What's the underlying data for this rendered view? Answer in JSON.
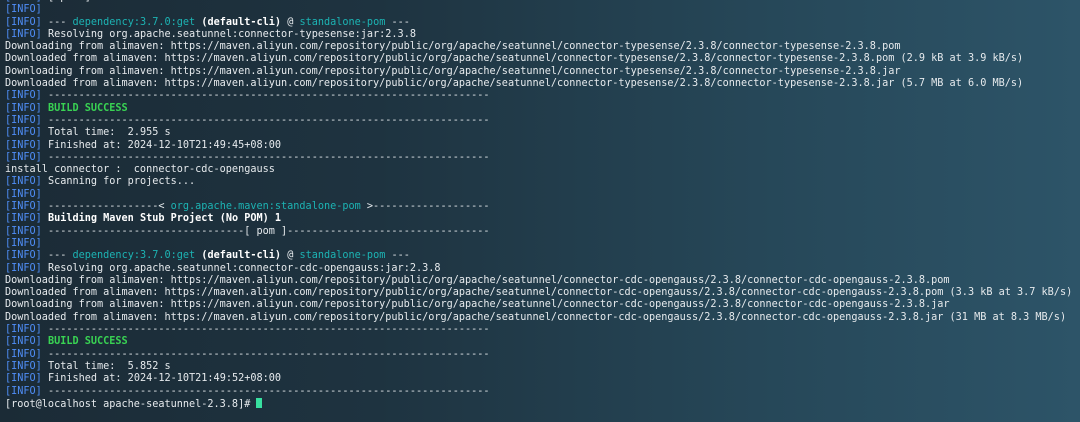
{
  "terminal": {
    "lines": [
      {
        "kind": "info_plain",
        "text": "[ pom ]"
      },
      {
        "kind": "info_plain",
        "text": ""
      },
      {
        "kind": "plugin",
        "plugin": "dependency:3.7.0:get",
        "goal": "(default-cli)",
        "at": "@",
        "project": "standalone-pom",
        "end": "---"
      },
      {
        "kind": "info_plain",
        "text": "Resolving org.apache.seatunnel:connector-typesense:jar:2.3.8"
      },
      {
        "kind": "plain",
        "text": "Downloading from alimaven: https://maven.aliyun.com/repository/public/org/apache/seatunnel/connector-typesense/2.3.8/connector-typesense-2.3.8.pom"
      },
      {
        "kind": "plain",
        "text": "Downloaded from alimaven: https://maven.aliyun.com/repository/public/org/apache/seatunnel/connector-typesense/2.3.8/connector-typesense-2.3.8.pom (2.9 kB at 3.9 kB/s)"
      },
      {
        "kind": "plain",
        "text": "Downloading from alimaven: https://maven.aliyun.com/repository/public/org/apache/seatunnel/connector-typesense/2.3.8/connector-typesense-2.3.8.jar"
      },
      {
        "kind": "plain",
        "text": "Downloaded from alimaven: https://maven.aliyun.com/repository/public/org/apache/seatunnel/connector-typesense/2.3.8/connector-typesense-2.3.8.jar (5.7 MB at 6.0 MB/s)"
      },
      {
        "kind": "info_plain",
        "text": "------------------------------------------------------------------------"
      },
      {
        "kind": "info_success",
        "text": "BUILD SUCCESS"
      },
      {
        "kind": "info_plain",
        "text": "------------------------------------------------------------------------"
      },
      {
        "kind": "info_plain",
        "text": "Total time:  2.955 s"
      },
      {
        "kind": "info_plain",
        "text": "Finished at: 2024-12-10T21:49:45+08:00"
      },
      {
        "kind": "info_plain",
        "text": "------------------------------------------------------------------------"
      },
      {
        "kind": "plain",
        "text": "install connector :  connector-cdc-opengauss"
      },
      {
        "kind": "info_plain",
        "text": "Scanning for projects..."
      },
      {
        "kind": "info_plain",
        "text": ""
      },
      {
        "kind": "header",
        "left": "------------------< ",
        "name": "org.apache.maven:standalone-pom",
        "right": " >-------------------"
      },
      {
        "kind": "info_bold",
        "text": "Building Maven Stub Project (No POM) 1"
      },
      {
        "kind": "info_plain",
        "text": "--------------------------------[ pom ]---------------------------------"
      },
      {
        "kind": "info_plain",
        "text": ""
      },
      {
        "kind": "plugin",
        "plugin": "dependency:3.7.0:get",
        "goal": "(default-cli)",
        "at": "@",
        "project": "standalone-pom",
        "end": "---"
      },
      {
        "kind": "info_plain",
        "text": "Resolving org.apache.seatunnel:connector-cdc-opengauss:jar:2.3.8"
      },
      {
        "kind": "plain",
        "text": "Downloading from alimaven: https://maven.aliyun.com/repository/public/org/apache/seatunnel/connector-cdc-opengauss/2.3.8/connector-cdc-opengauss-2.3.8.pom"
      },
      {
        "kind": "plain",
        "text": "Downloaded from alimaven: https://maven.aliyun.com/repository/public/org/apache/seatunnel/connector-cdc-opengauss/2.3.8/connector-cdc-opengauss-2.3.8.pom (3.3 kB at 3.7 kB/s)"
      },
      {
        "kind": "plain",
        "text": "Downloading from alimaven: https://maven.aliyun.com/repository/public/org/apache/seatunnel/connector-cdc-opengauss/2.3.8/connector-cdc-opengauss-2.3.8.jar"
      },
      {
        "kind": "plain",
        "text": "Downloaded from alimaven: https://maven.aliyun.com/repository/public/org/apache/seatunnel/connector-cdc-opengauss/2.3.8/connector-cdc-opengauss-2.3.8.jar (31 MB at 8.3 MB/s)"
      },
      {
        "kind": "info_plain",
        "text": "------------------------------------------------------------------------"
      },
      {
        "kind": "info_success",
        "text": "BUILD SUCCESS"
      },
      {
        "kind": "info_plain",
        "text": "------------------------------------------------------------------------"
      },
      {
        "kind": "info_plain",
        "text": "Total time:  5.852 s"
      },
      {
        "kind": "info_plain",
        "text": "Finished at: 2024-12-10T21:49:52+08:00"
      },
      {
        "kind": "info_plain",
        "text": "------------------------------------------------------------------------"
      },
      {
        "kind": "prompt",
        "text": "[root@localhost apache-seatunnel-2.3.8]#"
      }
    ],
    "level_tag": "[INFO]",
    "colors": {
      "info_tag": "#4f8ef7",
      "highlight": "#1cb3b3",
      "success": "#39d353",
      "text": "#e6eaed",
      "cursor": "#38e0a0"
    }
  }
}
